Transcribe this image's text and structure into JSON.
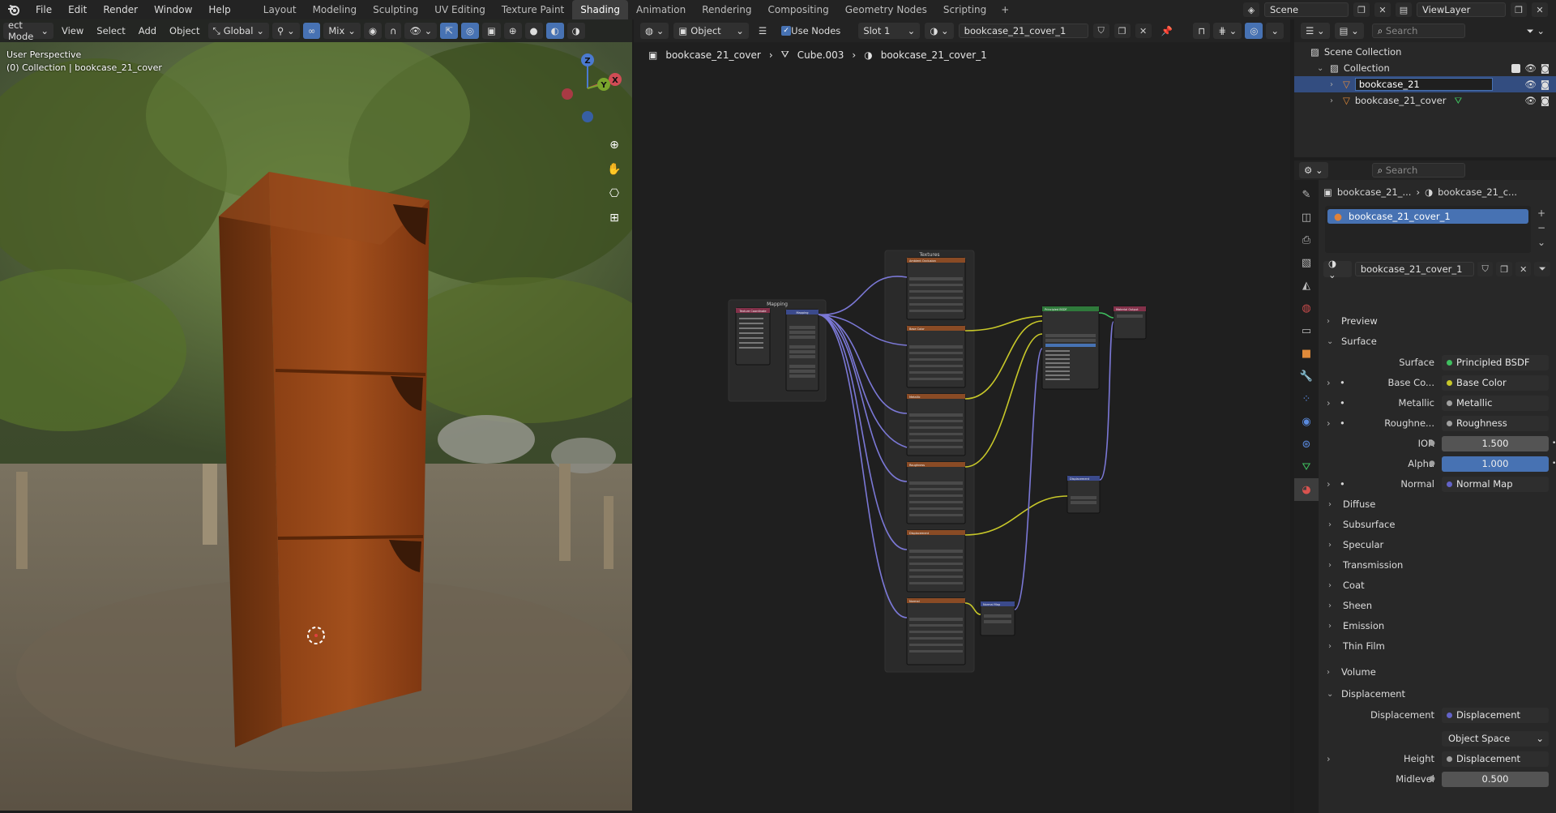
{
  "topbar": {
    "menus": [
      "File",
      "Edit",
      "Render",
      "Window",
      "Help"
    ],
    "workspaces": [
      "Layout",
      "Modeling",
      "Sculpting",
      "UV Editing",
      "Texture Paint",
      "Shading",
      "Animation",
      "Rendering",
      "Compositing",
      "Geometry Nodes",
      "Scripting"
    ],
    "active_workspace": "Shading",
    "scene": "Scene",
    "view_layer": "ViewLayer"
  },
  "viewport": {
    "mode": "ect Mode",
    "menus": [
      "View",
      "Select",
      "Add",
      "Object"
    ],
    "transform": "Global",
    "blend": "Mix",
    "info_line1": "User Perspective",
    "info_line2": "(0) Collection | bookcase_21_cover",
    "gizmo_axes": {
      "x": "X",
      "y": "Y",
      "z": "Z"
    }
  },
  "node_editor": {
    "type": "Object",
    "use_nodes_label": "Use Nodes",
    "slot": "Slot 1",
    "material": "bookcase_21_cover_1",
    "breadcrumb": [
      "bookcase_21_cover",
      "Cube.003",
      "bookcase_21_cover_1"
    ],
    "frames": {
      "mapping": "Mapping",
      "textures": "Textures"
    },
    "nodes": {
      "texcoord": "Texture Coordinate",
      "mapping": "Mapping",
      "tex1": "Ambient Occlusion",
      "tex2": "Base Color",
      "tex3": "Metallic",
      "tex4": "Roughness",
      "tex5": "Displacement",
      "tex6": "Normal",
      "bsdf": "Principled BSDF",
      "output": "Material Output",
      "displacement": "Displacement",
      "normalmap": "Normal Map"
    }
  },
  "outliner": {
    "search_placeholder": "Search",
    "scene_collection": "Scene Collection",
    "collection": "Collection",
    "items": [
      {
        "name": "bookcase_21",
        "selected": true
      },
      {
        "name": "bookcase_21_cover",
        "selected": false
      }
    ]
  },
  "properties": {
    "search_placeholder": "Search",
    "crumb1": "bookcase_21_...",
    "crumb2": "bookcase_21_c...",
    "slot_name": "bookcase_21_cover_1",
    "material_name": "bookcase_21_cover_1",
    "sections": {
      "preview": "Preview",
      "surface": "Surface",
      "volume": "Volume",
      "displacement": "Displacement"
    },
    "surface_rows": [
      {
        "label": "Surface",
        "value": "Principled BSDF",
        "dot": "#3fbf5f"
      },
      {
        "label": "Base Co...",
        "value": "Base Color",
        "dot": "#c7c729"
      },
      {
        "label": "Metallic",
        "value": "Metallic",
        "dot": "#a1a1a1"
      },
      {
        "label": "Roughne...",
        "value": "Roughness",
        "dot": "#a1a1a1"
      }
    ],
    "ior": {
      "label": "IOR",
      "value": "1.500"
    },
    "alpha": {
      "label": "Alpha",
      "value": "1.000"
    },
    "normal": {
      "label": "Normal",
      "value": "Normal Map",
      "dot": "#6363c7"
    },
    "subpanels": [
      "Diffuse",
      "Subsurface",
      "Specular",
      "Transmission",
      "Coat",
      "Sheen",
      "Emission",
      "Thin Film"
    ],
    "disp_rows": {
      "displacement_label": "Displacement",
      "displacement_value": "Displacement",
      "space": "Object Space",
      "height_label": "Height",
      "height_value": "Displacement",
      "midlevel_label": "Midlevel",
      "midlevel_value": "0.500"
    },
    "colors": {
      "accent": "#4772b3",
      "selection": "#334d80"
    }
  }
}
